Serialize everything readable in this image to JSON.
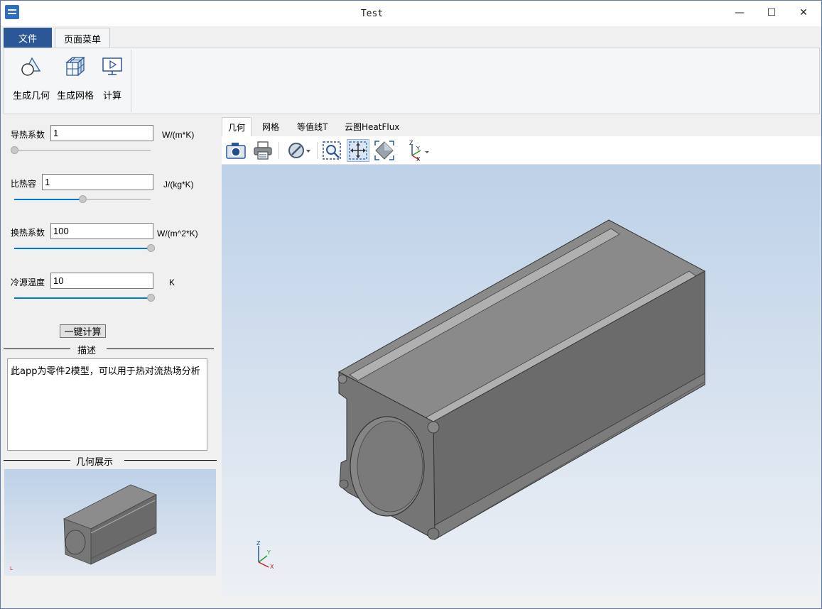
{
  "window": {
    "title": "Test"
  },
  "title_buttons": {
    "minimize": "—",
    "maximize": "☐",
    "close": "✕"
  },
  "ribbon": {
    "tabs": [
      {
        "label": "文件"
      },
      {
        "label": "页面菜单"
      }
    ],
    "buttons": [
      {
        "label": "生成几何",
        "icon": "shapes-icon"
      },
      {
        "label": "生成网格",
        "icon": "mesh-cube-icon"
      },
      {
        "label": "计算",
        "icon": "monitor-play-icon"
      }
    ]
  },
  "params": [
    {
      "label": "导热系数",
      "value": "1",
      "unit": "W/(m*K)",
      "slider_fraction": 0.0
    },
    {
      "label": "比热容",
      "value": "1",
      "unit": "J/(kg*K)",
      "slider_fraction": 0.5
    },
    {
      "label": "换热系数",
      "value": "100",
      "unit": "W/(m^2*K)",
      "slider_fraction": 1.0
    },
    {
      "label": "冷源温度",
      "value": "10",
      "unit": "K",
      "slider_fraction": 1.0
    }
  ],
  "calc_button": "一键计算",
  "description": {
    "title": "描述",
    "text": "此app为零件2模型，可以用于热对流热场分析"
  },
  "preview": {
    "title": "几何展示"
  },
  "view_tabs": [
    {
      "label": "几何",
      "active": true
    },
    {
      "label": "网格",
      "active": false
    },
    {
      "label": "等值线T",
      "active": false
    },
    {
      "label": "云图HeatFlux",
      "active": false
    }
  ],
  "toolbar": [
    {
      "icon": "camera-icon"
    },
    {
      "icon": "printer-icon"
    },
    {
      "icon": "display-mode-icon"
    },
    {
      "icon": "zoom-box-icon"
    },
    {
      "icon": "pan-icon"
    },
    {
      "icon": "fit-view-icon"
    },
    {
      "icon": "axis-view-icon"
    }
  ],
  "axes": {
    "x": "X",
    "y": "Y",
    "z": "Z"
  },
  "colors": {
    "accent": "#2b5797",
    "slider": "#0078d7",
    "model": "#6e6e6e"
  }
}
